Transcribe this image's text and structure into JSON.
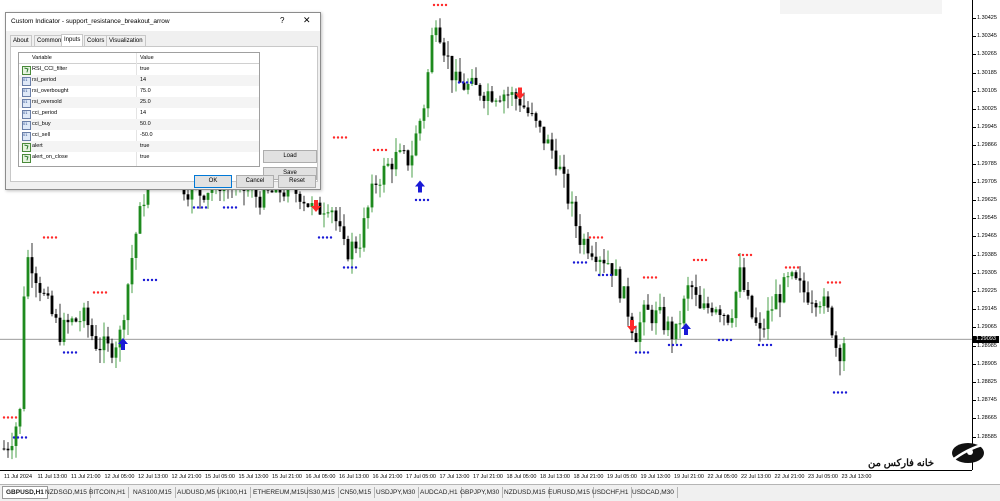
{
  "dialog": {
    "title": "Custom Indicator - support_resistance_breakout_arrow",
    "help_glyph": "?",
    "close_glyph": "✕",
    "tabs": [
      "About",
      "Common",
      "Inputs",
      "Colors",
      "Visualization"
    ],
    "active_tab": "Inputs",
    "columns": [
      "Variable",
      "Value"
    ],
    "params": [
      {
        "name": "RSI_CCI_filter",
        "value": "true",
        "kind": "bool"
      },
      {
        "name": "rsi_period",
        "value": "14",
        "kind": "num"
      },
      {
        "name": "rsi_overbought",
        "value": "75.0",
        "kind": "num"
      },
      {
        "name": "rsi_oversold",
        "value": "25.0",
        "kind": "num"
      },
      {
        "name": "cci_period",
        "value": "14",
        "kind": "num"
      },
      {
        "name": "cci_buy",
        "value": "50.0",
        "kind": "num"
      },
      {
        "name": "cci_sell",
        "value": "-50.0",
        "kind": "num"
      },
      {
        "name": "alert",
        "value": "true",
        "kind": "bool"
      },
      {
        "name": "alert_on_close",
        "value": "true",
        "kind": "bool"
      }
    ],
    "load_label": "Load",
    "save_label": "Save",
    "ok_label": "OK",
    "cancel_label": "Cancel",
    "reset_label": "Reset"
  },
  "price_axis": {
    "labels": [
      "1.30425",
      "1.30345",
      "1.30265",
      "1.30185",
      "1.30105",
      "1.30025",
      "1.29945",
      "1.29866",
      "1.29785",
      "1.29705",
      "1.29625",
      "1.29545",
      "1.29465",
      "1.29385",
      "1.29305",
      "1.29225",
      "1.29145",
      "1.29065",
      "1.28985",
      "1.28905",
      "1.28825",
      "1.28745",
      "1.28665",
      "1.28585"
    ],
    "current_price": "1.29093"
  },
  "time_axis": {
    "labels": [
      "11 Jul 2024",
      "11 Jul 13:00",
      "11 Jul 21:00",
      "12 Jul 05:00",
      "12 Jul 13:00",
      "12 Jul 21:00",
      "15 Jul 05:00",
      "15 Jul 13:00",
      "15 Jul 21:00",
      "16 Jul 05:00",
      "16 Jul 13:00",
      "16 Jul 21:00",
      "17 Jul 05:00",
      "17 Jul 13:00",
      "17 Jul 21:00",
      "18 Jul 05:00",
      "18 Jul 13:00",
      "18 Jul 21:00",
      "19 Jul 05:00",
      "19 Jul 13:00",
      "19 Jul 21:00",
      "22 Jul 05:00",
      "22 Jul 13:00",
      "22 Jul 21:00",
      "23 Jul 05:00",
      "23 Jul 13:00"
    ]
  },
  "tabs": [
    "GBPUSD,H1",
    "NZDSGD,M15",
    "BITCOIN,H1",
    "NAS100,M15",
    "AUDUSD,M5",
    "UK100,H1",
    "ETHEREUM,M15",
    "US30,M15",
    "CN50,M15",
    "USDJPY,M30",
    "AUDCAD,H1",
    "GBPJPY,M30",
    "NZDUSD,M15",
    "EURUSD,M15",
    "USDCHF,H1",
    "USDCAD,M30"
  ],
  "active_tab": "GBPUSD,H1",
  "watermark": {
    "text": "خانه فارکس من"
  },
  "colors": {
    "bull": "#1e8a1e",
    "bear": "#000000",
    "resistance_dots": "#ff2a2a",
    "support_dots": "#1a1ad6",
    "buy_arrow": "#1a1ad6",
    "sell_arrow": "#ff2a2a",
    "price_line": "#7a7a7a"
  },
  "chart_data": {
    "type": "candlestick",
    "symbol": "GBPUSD,H1",
    "ylim": [
      1.2857,
      1.3045
    ],
    "current_price": 1.29093,
    "close_path": [
      [
        0,
        1.2864
      ],
      [
        10,
        1.2868
      ],
      [
        20,
        1.288
      ],
      [
        25,
        1.2941
      ],
      [
        30,
        1.2942
      ],
      [
        45,
        1.2925
      ],
      [
        60,
        1.2912
      ],
      [
        70,
        1.2916
      ],
      [
        85,
        1.2918
      ],
      [
        95,
        1.2908
      ],
      [
        110,
        1.2905
      ],
      [
        120,
        1.2911
      ],
      [
        135,
        1.295
      ],
      [
        145,
        1.2968
      ],
      [
        160,
        1.299
      ],
      [
        175,
        1.2978
      ],
      [
        185,
        1.297
      ],
      [
        200,
        1.2968
      ],
      [
        220,
        1.2972
      ],
      [
        240,
        1.297
      ],
      [
        260,
        1.2966
      ],
      [
        280,
        1.2969
      ],
      [
        300,
        1.2968
      ],
      [
        315,
        1.296
      ],
      [
        330,
        1.2965
      ],
      [
        345,
        1.2944
      ],
      [
        360,
        1.2949
      ],
      [
        375,
        1.2972
      ],
      [
        395,
        1.2982
      ],
      [
        410,
        1.2981
      ],
      [
        425,
        1.3005
      ],
      [
        435,
        1.304
      ],
      [
        445,
        1.3025
      ],
      [
        455,
        1.3012
      ],
      [
        470,
        1.301
      ],
      [
        490,
        1.3008
      ],
      [
        505,
        1.3008
      ],
      [
        520,
        1.3005
      ],
      [
        540,
        1.2992
      ],
      [
        555,
        1.2983
      ],
      [
        565,
        1.297
      ],
      [
        580,
        1.295
      ],
      [
        595,
        1.2945
      ],
      [
        610,
        1.294
      ],
      [
        625,
        1.2925
      ],
      [
        635,
        1.2911
      ],
      [
        645,
        1.292
      ],
      [
        660,
        1.2918
      ],
      [
        675,
        1.291
      ],
      [
        690,
        1.2932
      ],
      [
        700,
        1.292
      ],
      [
        715,
        1.2924
      ],
      [
        730,
        1.2918
      ],
      [
        740,
        1.2935
      ],
      [
        750,
        1.292
      ],
      [
        760,
        1.2911
      ],
      [
        775,
        1.2925
      ],
      [
        790,
        1.2933
      ],
      [
        805,
        1.2928
      ],
      [
        820,
        1.2926
      ],
      [
        830,
        1.2918
      ],
      [
        838,
        1.2903
      ],
      [
        845,
        1.291
      ]
    ],
    "markers": [
      {
        "type": "resistance",
        "x": 10,
        "price": 1.2878
      },
      {
        "type": "resistance",
        "x": 50,
        "price": 1.295
      },
      {
        "type": "resistance",
        "x": 100,
        "price": 1.2928
      },
      {
        "type": "resistance",
        "x": 380,
        "price": 1.2985
      },
      {
        "type": "resistance",
        "x": 340,
        "price": 1.299
      },
      {
        "type": "resistance",
        "x": 440,
        "price": 1.3043
      },
      {
        "type": "resistance",
        "x": 596,
        "price": 1.295
      },
      {
        "type": "resistance",
        "x": 650,
        "price": 1.2934
      },
      {
        "type": "resistance",
        "x": 700,
        "price": 1.2941
      },
      {
        "type": "resistance",
        "x": 745,
        "price": 1.2943
      },
      {
        "type": "resistance",
        "x": 792,
        "price": 1.2938
      },
      {
        "type": "resistance",
        "x": 834,
        "price": 1.2932
      },
      {
        "type": "support",
        "x": 20,
        "price": 1.287
      },
      {
        "type": "support",
        "x": 70,
        "price": 1.2904
      },
      {
        "type": "support",
        "x": 150,
        "price": 1.2933
      },
      {
        "type": "support",
        "x": 200,
        "price": 1.2962
      },
      {
        "type": "support",
        "x": 230,
        "price": 1.2962
      },
      {
        "type": "support",
        "x": 325,
        "price": 1.295
      },
      {
        "type": "support",
        "x": 350,
        "price": 1.2938
      },
      {
        "type": "support",
        "x": 422,
        "price": 1.2965
      },
      {
        "type": "support",
        "x": 465,
        "price": 1.3012
      },
      {
        "type": "support",
        "x": 580,
        "price": 1.294
      },
      {
        "type": "support",
        "x": 605,
        "price": 1.2935
      },
      {
        "type": "support",
        "x": 642,
        "price": 1.2904
      },
      {
        "type": "support",
        "x": 675,
        "price": 1.2907
      },
      {
        "type": "support",
        "x": 725,
        "price": 1.2909
      },
      {
        "type": "support",
        "x": 765,
        "price": 1.2907
      },
      {
        "type": "support",
        "x": 840,
        "price": 1.2888
      },
      {
        "type": "buy_arrow",
        "x": 123,
        "price": 1.2907
      },
      {
        "type": "buy_arrow",
        "x": 420,
        "price": 1.297
      },
      {
        "type": "buy_arrow",
        "x": 686,
        "price": 1.2913
      },
      {
        "type": "sell_arrow",
        "x": 316,
        "price": 1.2963
      },
      {
        "type": "sell_arrow",
        "x": 520,
        "price": 1.3008
      },
      {
        "type": "sell_arrow",
        "x": 632,
        "price": 1.2915
      }
    ]
  }
}
